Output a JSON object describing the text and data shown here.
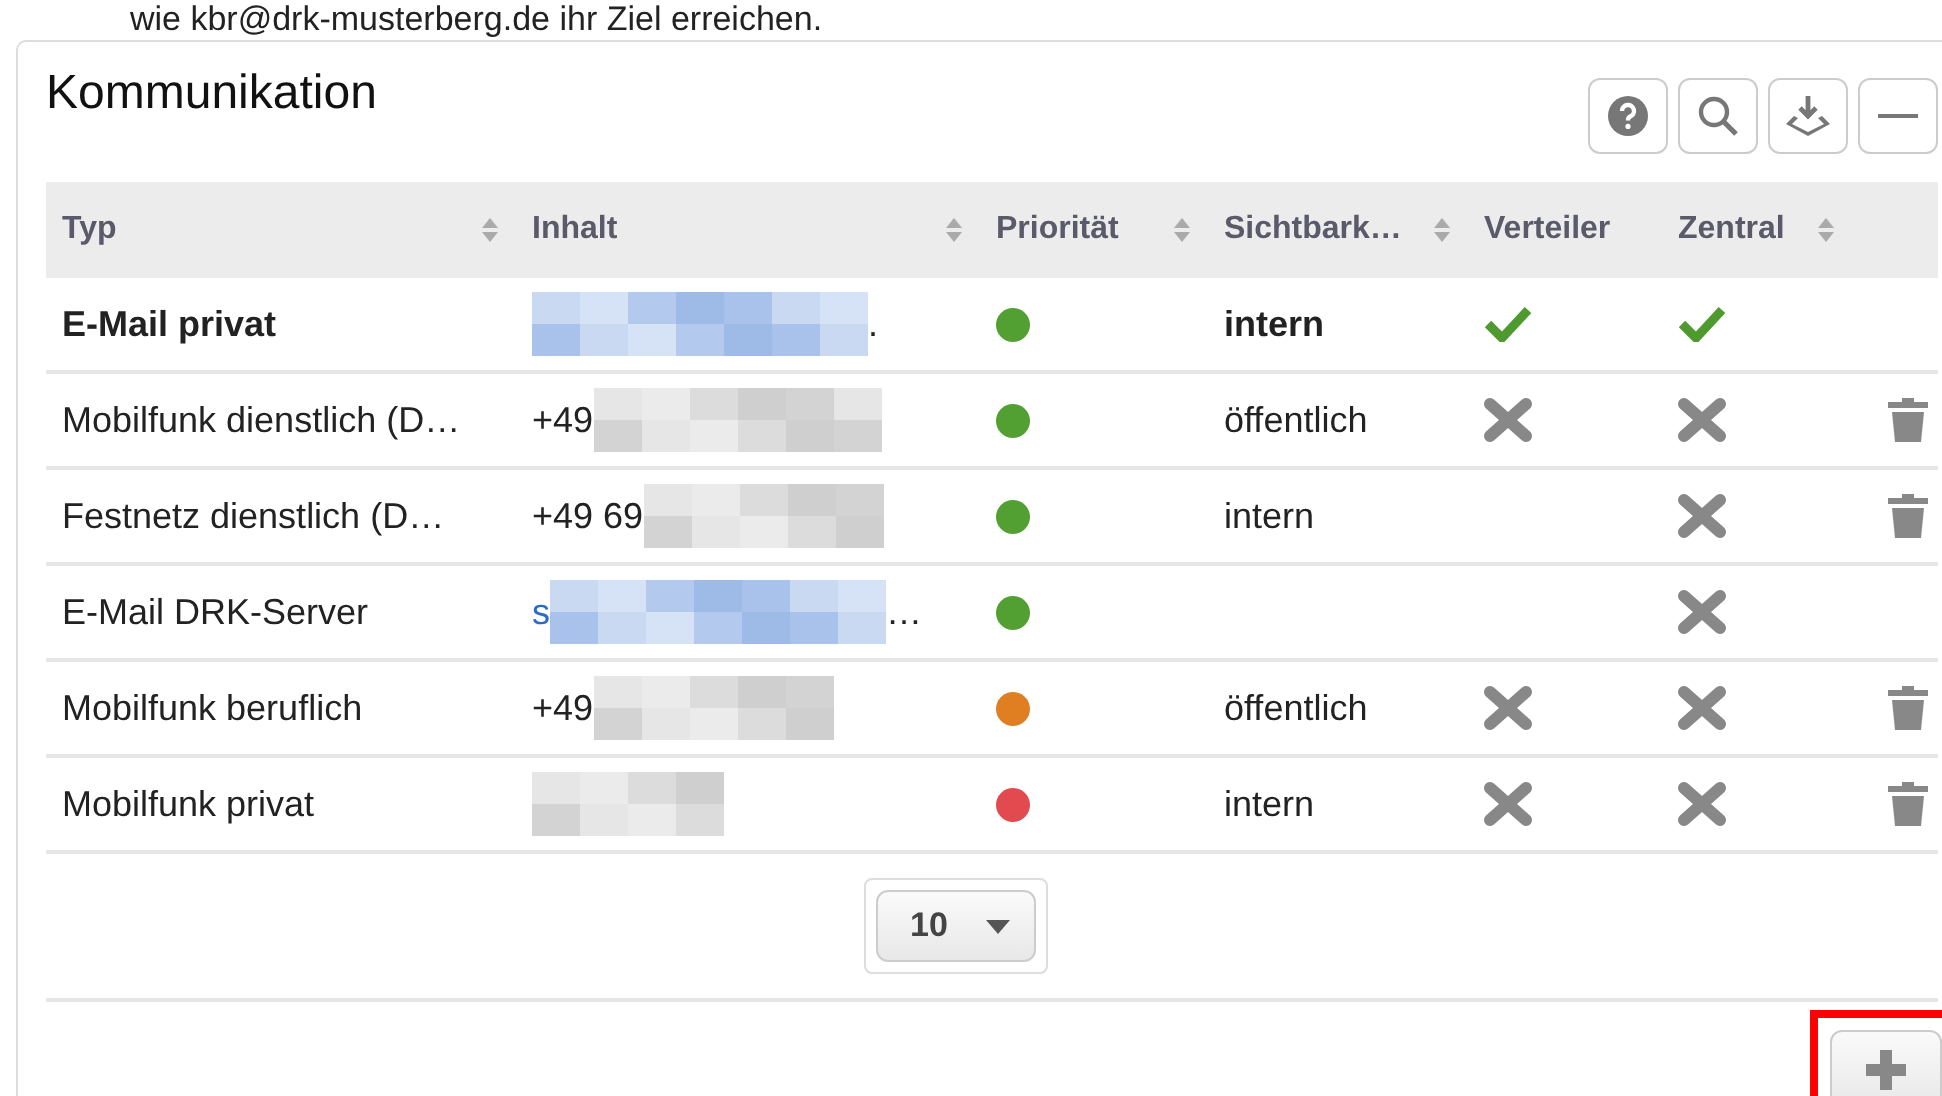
{
  "intro_text": "wie kbr@drk-musterberg.de ihr Ziel erreichen.",
  "panel": {
    "title": "Kommunikation",
    "toolbar": [
      {
        "kind": "help"
      },
      {
        "kind": "search"
      },
      {
        "kind": "download"
      },
      {
        "kind": "collapse"
      }
    ]
  },
  "table": {
    "columns": [
      {
        "label": "Typ",
        "sortable": true
      },
      {
        "label": "Inhalt",
        "sortable": true
      },
      {
        "label": "Priorität",
        "sortable": true
      },
      {
        "label": "Sichtbark…",
        "sortable": true
      },
      {
        "label": "Verteiler",
        "sortable": false
      },
      {
        "label": "Zentral",
        "sortable": true
      }
    ],
    "rows": [
      {
        "kind": "email",
        "typ": "E-Mail privat",
        "bold": true,
        "content_suffix": ".",
        "color": "#52a032",
        "sichtbarkeit": "intern",
        "verteiler": true,
        "zentral": true,
        "deletable": false
      },
      {
        "kind": "phone",
        "typ": "Mobilfunk dienstlich (D…",
        "bold": false,
        "content_prefix": "+49",
        "color": "#52a032",
        "sichtbarkeit": "öffentlich",
        "verteiler": false,
        "zentral": false,
        "deletable": true
      },
      {
        "kind": "phone",
        "typ": "Festnetz dienstlich (D…",
        "bold": false,
        "content_prefix": "+49 69",
        "color": "#52a032",
        "sichtbarkeit": "intern",
        "zentral": false,
        "deletable": true
      },
      {
        "kind": "email",
        "typ": "E-Mail DRK-Server",
        "bold": false,
        "content_prefix": "s",
        "content_suffix": "…",
        "color": "#52a032",
        "zentral": false,
        "deletable": false
      },
      {
        "kind": "phone",
        "typ": "Mobilfunk beruflich",
        "bold": false,
        "content_prefix": "+49",
        "color": "#e07f22",
        "sichtbarkeit": "öffentlich",
        "verteiler": false,
        "zentral": false,
        "deletable": true
      },
      {
        "kind": "phone",
        "typ": "Mobilfunk privat",
        "bold": false,
        "color": "#e34a4f",
        "sichtbarkeit": "intern",
        "verteiler": false,
        "zentral": false,
        "deletable": true
      }
    ]
  },
  "page_size": "10",
  "add_button": {
    "highlighted": true
  }
}
